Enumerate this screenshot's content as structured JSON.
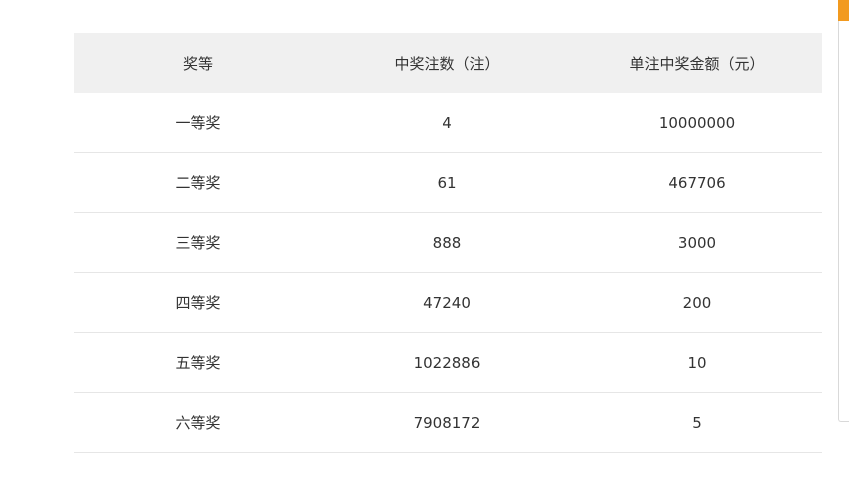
{
  "table": {
    "headers": [
      "奖等",
      "中奖注数（注）",
      "单注中奖金额（元）"
    ],
    "rows": [
      {
        "level": "一等奖",
        "count": "4",
        "amount": "10000000"
      },
      {
        "level": "二等奖",
        "count": "61",
        "amount": "467706"
      },
      {
        "level": "三等奖",
        "count": "888",
        "amount": "3000"
      },
      {
        "level": "四等奖",
        "count": "47240",
        "amount": "200"
      },
      {
        "level": "五等奖",
        "count": "1022886",
        "amount": "10"
      },
      {
        "level": "六等奖",
        "count": "7908172",
        "amount": "5"
      }
    ]
  },
  "colors": {
    "header_bg": "#f0f0f0",
    "row_border": "#e6e6e6",
    "text": "#333333",
    "accent": "#f29a1f"
  }
}
